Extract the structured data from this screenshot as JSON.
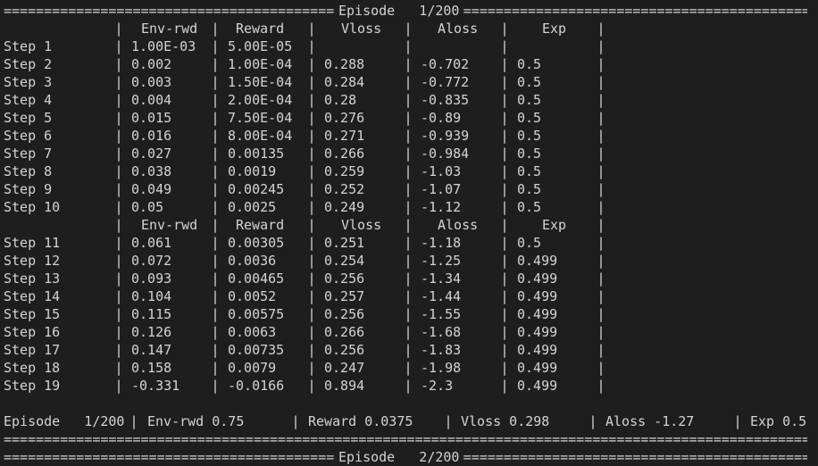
{
  "episode_header_top": {
    "label": "Episode",
    "value": "1/200"
  },
  "episode_header_bottom": {
    "label": "Episode",
    "value": "2/200"
  },
  "columns": [
    "Env-rwd",
    "Reward",
    "Vloss",
    "Aloss",
    "Exp"
  ],
  "rows_block1": [
    {
      "step": "Step 1",
      "env": "1.00E-03",
      "reward": "5.00E-05",
      "vloss": "",
      "aloss": "",
      "exp": ""
    },
    {
      "step": "Step 2",
      "env": "0.002",
      "reward": "1.00E-04",
      "vloss": "0.288",
      "aloss": "-0.702",
      "exp": "0.5"
    },
    {
      "step": "Step 3",
      "env": "0.003",
      "reward": "1.50E-04",
      "vloss": "0.284",
      "aloss": "-0.772",
      "exp": "0.5"
    },
    {
      "step": "Step 4",
      "env": "0.004",
      "reward": "2.00E-04",
      "vloss": "0.28",
      "aloss": "-0.835",
      "exp": "0.5"
    },
    {
      "step": "Step 5",
      "env": "0.015",
      "reward": "7.50E-04",
      "vloss": "0.276",
      "aloss": "-0.89",
      "exp": "0.5"
    },
    {
      "step": "Step 6",
      "env": "0.016",
      "reward": "8.00E-04",
      "vloss": "0.271",
      "aloss": "-0.939",
      "exp": "0.5"
    },
    {
      "step": "Step 7",
      "env": "0.027",
      "reward": "0.00135",
      "vloss": "0.266",
      "aloss": "-0.984",
      "exp": "0.5"
    },
    {
      "step": "Step 8",
      "env": "0.038",
      "reward": "0.0019",
      "vloss": "0.259",
      "aloss": "-1.03",
      "exp": "0.5"
    },
    {
      "step": "Step 9",
      "env": "0.049",
      "reward": "0.00245",
      "vloss": "0.252",
      "aloss": "-1.07",
      "exp": "0.5"
    },
    {
      "step": "Step 10",
      "env": "0.05",
      "reward": "0.0025",
      "vloss": "0.249",
      "aloss": "-1.12",
      "exp": "0.5"
    }
  ],
  "rows_block2": [
    {
      "step": "Step 11",
      "env": "0.061",
      "reward": "0.00305",
      "vloss": "0.251",
      "aloss": "-1.18",
      "exp": "0.5"
    },
    {
      "step": "Step 12",
      "env": "0.072",
      "reward": "0.0036",
      "vloss": "0.254",
      "aloss": "-1.25",
      "exp": "0.499"
    },
    {
      "step": "Step 13",
      "env": "0.093",
      "reward": "0.00465",
      "vloss": "0.256",
      "aloss": "-1.34",
      "exp": "0.499"
    },
    {
      "step": "Step 14",
      "env": "0.104",
      "reward": "0.0052",
      "vloss": "0.257",
      "aloss": "-1.44",
      "exp": "0.499"
    },
    {
      "step": "Step 15",
      "env": "0.115",
      "reward": "0.00575",
      "vloss": "0.256",
      "aloss": "-1.55",
      "exp": "0.499"
    },
    {
      "step": "Step 16",
      "env": "0.126",
      "reward": "0.0063",
      "vloss": "0.266",
      "aloss": "-1.68",
      "exp": "0.499"
    },
    {
      "step": "Step 17",
      "env": "0.147",
      "reward": "0.00735",
      "vloss": "0.256",
      "aloss": "-1.83",
      "exp": "0.499"
    },
    {
      "step": "Step 18",
      "env": "0.158",
      "reward": "0.0079",
      "vloss": "0.247",
      "aloss": "-1.98",
      "exp": "0.499"
    },
    {
      "step": "Step 19",
      "env": "-0.331",
      "reward": "-0.0166",
      "vloss": "0.894",
      "aloss": "-2.3",
      "exp": "0.499"
    }
  ],
  "summary": {
    "episode": "Episode   1/200",
    "env": "Env-rwd 0.75",
    "reward": "Reward 0.0375",
    "vloss": "Vloss 0.298",
    "aloss": "Aloss -1.27",
    "exp": "Exp 0.5"
  },
  "colors": {
    "background": "#1e1e1e",
    "text": "#d4d4d4"
  }
}
